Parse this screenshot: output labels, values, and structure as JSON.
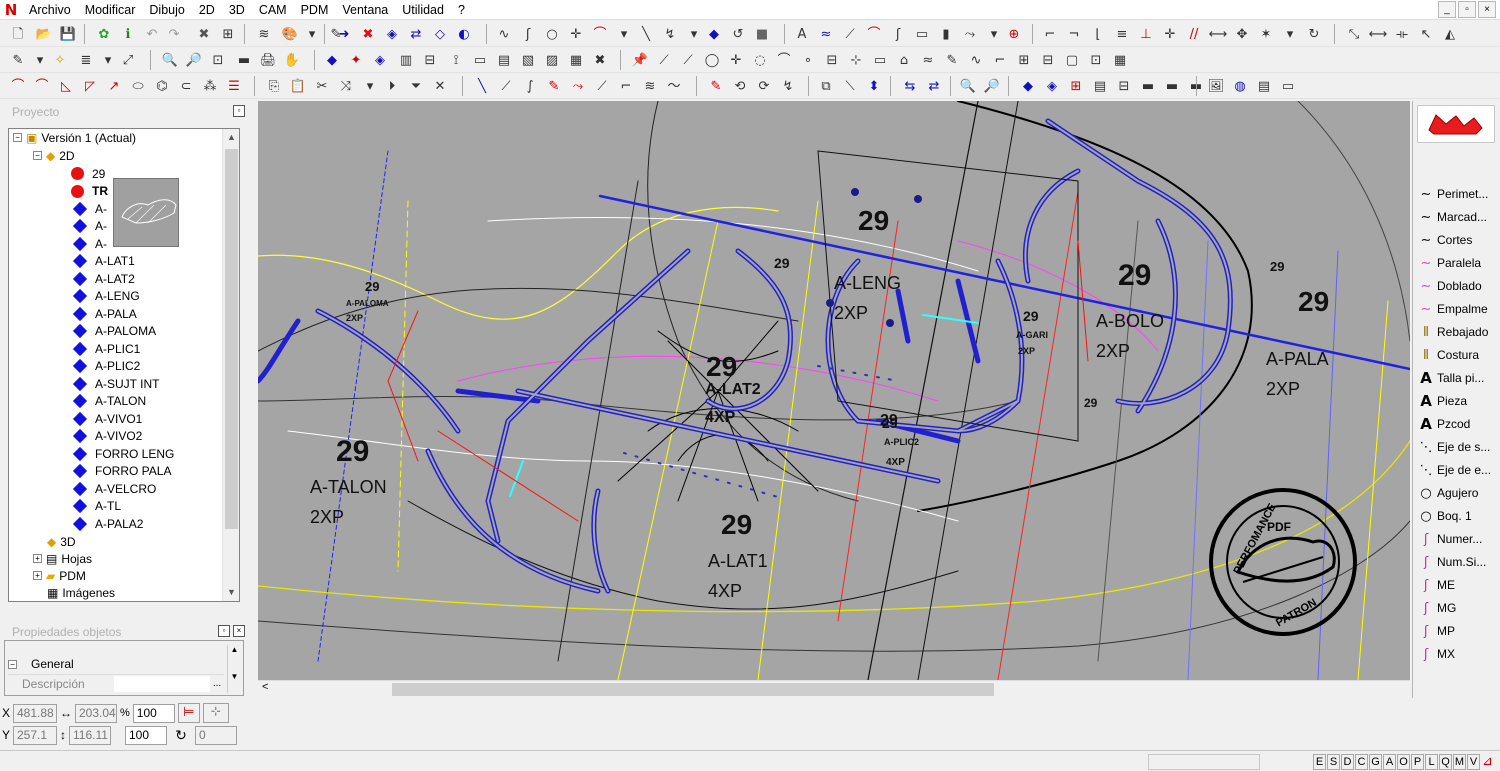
{
  "menu": [
    "Archivo",
    "Modificar",
    "Dibujo",
    "2D",
    "3D",
    "CAM",
    "PDM",
    "Ventana",
    "Utilidad",
    "?"
  ],
  "window_buttons": [
    "_",
    "▫",
    "×"
  ],
  "panels": {
    "proyecto_title": "Proyecto",
    "propiedades_title": "Propiedades objetos",
    "general": "General",
    "descripcion": "Descripción",
    "ellipsis": "..."
  },
  "tree": {
    "root": "Versión 1 (Actual)",
    "group_2d": "2D",
    "red_items": [
      "29",
      "TR"
    ],
    "blue_items": [
      "A-",
      "A-",
      "A-",
      "A-LAT1",
      "A-LAT2",
      "A-LENG",
      "A-PALA",
      "A-PALOMA",
      "A-PLIC1",
      "A-PLIC2",
      "A-SUJT INT",
      "A-TALON",
      "A-VIVO1",
      "A-VIVO2",
      "FORRO LENG",
      "FORRO PALA",
      "A-VELCRO",
      "A-TL",
      "A-PALA2"
    ],
    "group_3d": "3D",
    "hojas": "Hojas",
    "pdm": "PDM",
    "imagenes": "Imágenes"
  },
  "coords": {
    "x_label": "X",
    "x_value": "481.88",
    "width_value": "203.04",
    "scale_x": "100",
    "y_label": "Y",
    "y_value": "257.1",
    "height_value": "116.11",
    "scale_y": "100",
    "percent": "%",
    "rotation": "0"
  },
  "right_palette": {
    "items": [
      {
        "label": "Perimet...",
        "icon": "curve"
      },
      {
        "label": "Marcad...",
        "icon": "curve"
      },
      {
        "label": "Cortes",
        "icon": "curve"
      },
      {
        "label": "Paralela",
        "icon": "pink-curve"
      },
      {
        "label": "Doblado",
        "icon": "pink-curve"
      },
      {
        "label": "Empalme",
        "icon": "pink-curve"
      },
      {
        "label": "Rebajado",
        "icon": "sew"
      },
      {
        "label": "Costura",
        "icon": "sew"
      },
      {
        "label": "Talla pi...",
        "icon": "text-a"
      },
      {
        "label": "Pieza",
        "icon": "text-a"
      },
      {
        "label": "Pzcod",
        "icon": "text-a"
      },
      {
        "label": "Eje de s...",
        "icon": "dash"
      },
      {
        "label": "Eje de e...",
        "icon": "dash"
      },
      {
        "label": "Agujero",
        "icon": "circle"
      },
      {
        "label": "Boq. 1",
        "icon": "circle"
      },
      {
        "label": "Numer...",
        "icon": "pink-pen"
      },
      {
        "label": "Num.Si...",
        "icon": "pink-pen"
      },
      {
        "label": "ME",
        "icon": "pink-pen"
      },
      {
        "label": "MG",
        "icon": "pink-pen"
      },
      {
        "label": "MP",
        "icon": "pink-pen"
      },
      {
        "label": "MX",
        "icon": "pink-pen"
      }
    ]
  },
  "canvas": {
    "labels": [
      {
        "text": "29",
        "size": "big"
      },
      {
        "text": "29",
        "size": "big"
      },
      {
        "text": "29",
        "size": "big"
      },
      {
        "text": "29",
        "size": "big"
      },
      {
        "text": "29",
        "size": "big"
      },
      {
        "text": "29",
        "size": "mid"
      },
      {
        "text": "29",
        "size": "mid"
      },
      {
        "text": "29",
        "size": "mid"
      },
      {
        "text": "29",
        "size": "mid"
      },
      {
        "text": "A-LENG",
        "size": "mid"
      },
      {
        "text": "2XP",
        "size": "mid"
      },
      {
        "text": "A-BOLO",
        "size": "mid"
      },
      {
        "text": "2XP",
        "size": "mid"
      },
      {
        "text": "A-PALA",
        "size": "mid"
      },
      {
        "text": "2XP",
        "size": "mid"
      },
      {
        "text": "A-TALON",
        "size": "mid"
      },
      {
        "text": "2XP",
        "size": "mid"
      },
      {
        "text": "A-LAT1",
        "size": "mid"
      },
      {
        "text": "4XP",
        "size": "mid"
      },
      {
        "text": "A-LAT2",
        "size": "mid"
      },
      {
        "text": "4XP",
        "size": "mid"
      },
      {
        "text": "29",
        "size": "small"
      },
      {
        "text": "A-PALOMA",
        "size": "small"
      },
      {
        "text": "2XP",
        "size": "small"
      },
      {
        "text": "29",
        "size": "small"
      },
      {
        "text": "A-PLIC2",
        "size": "small"
      },
      {
        "text": "4XP",
        "size": "small"
      },
      {
        "text": "29",
        "size": "small"
      },
      {
        "text": "A-GARI",
        "size": "small"
      },
      {
        "text": "2XP",
        "size": "small"
      },
      {
        "text": "29",
        "size": "small"
      }
    ],
    "watermark": {
      "top": "PERFOMANCE",
      "center": "PDF",
      "bottom": "PATRON"
    }
  },
  "statusbar": {
    "letters": [
      "E",
      "S",
      "D",
      "C",
      "G",
      "A",
      "O",
      "P",
      "L",
      "Q",
      "M",
      "V"
    ]
  },
  "colors": {
    "canvas_bg": "#a5a5a5",
    "blue_piece": "#2020d0",
    "highlight": "#2121e0"
  }
}
